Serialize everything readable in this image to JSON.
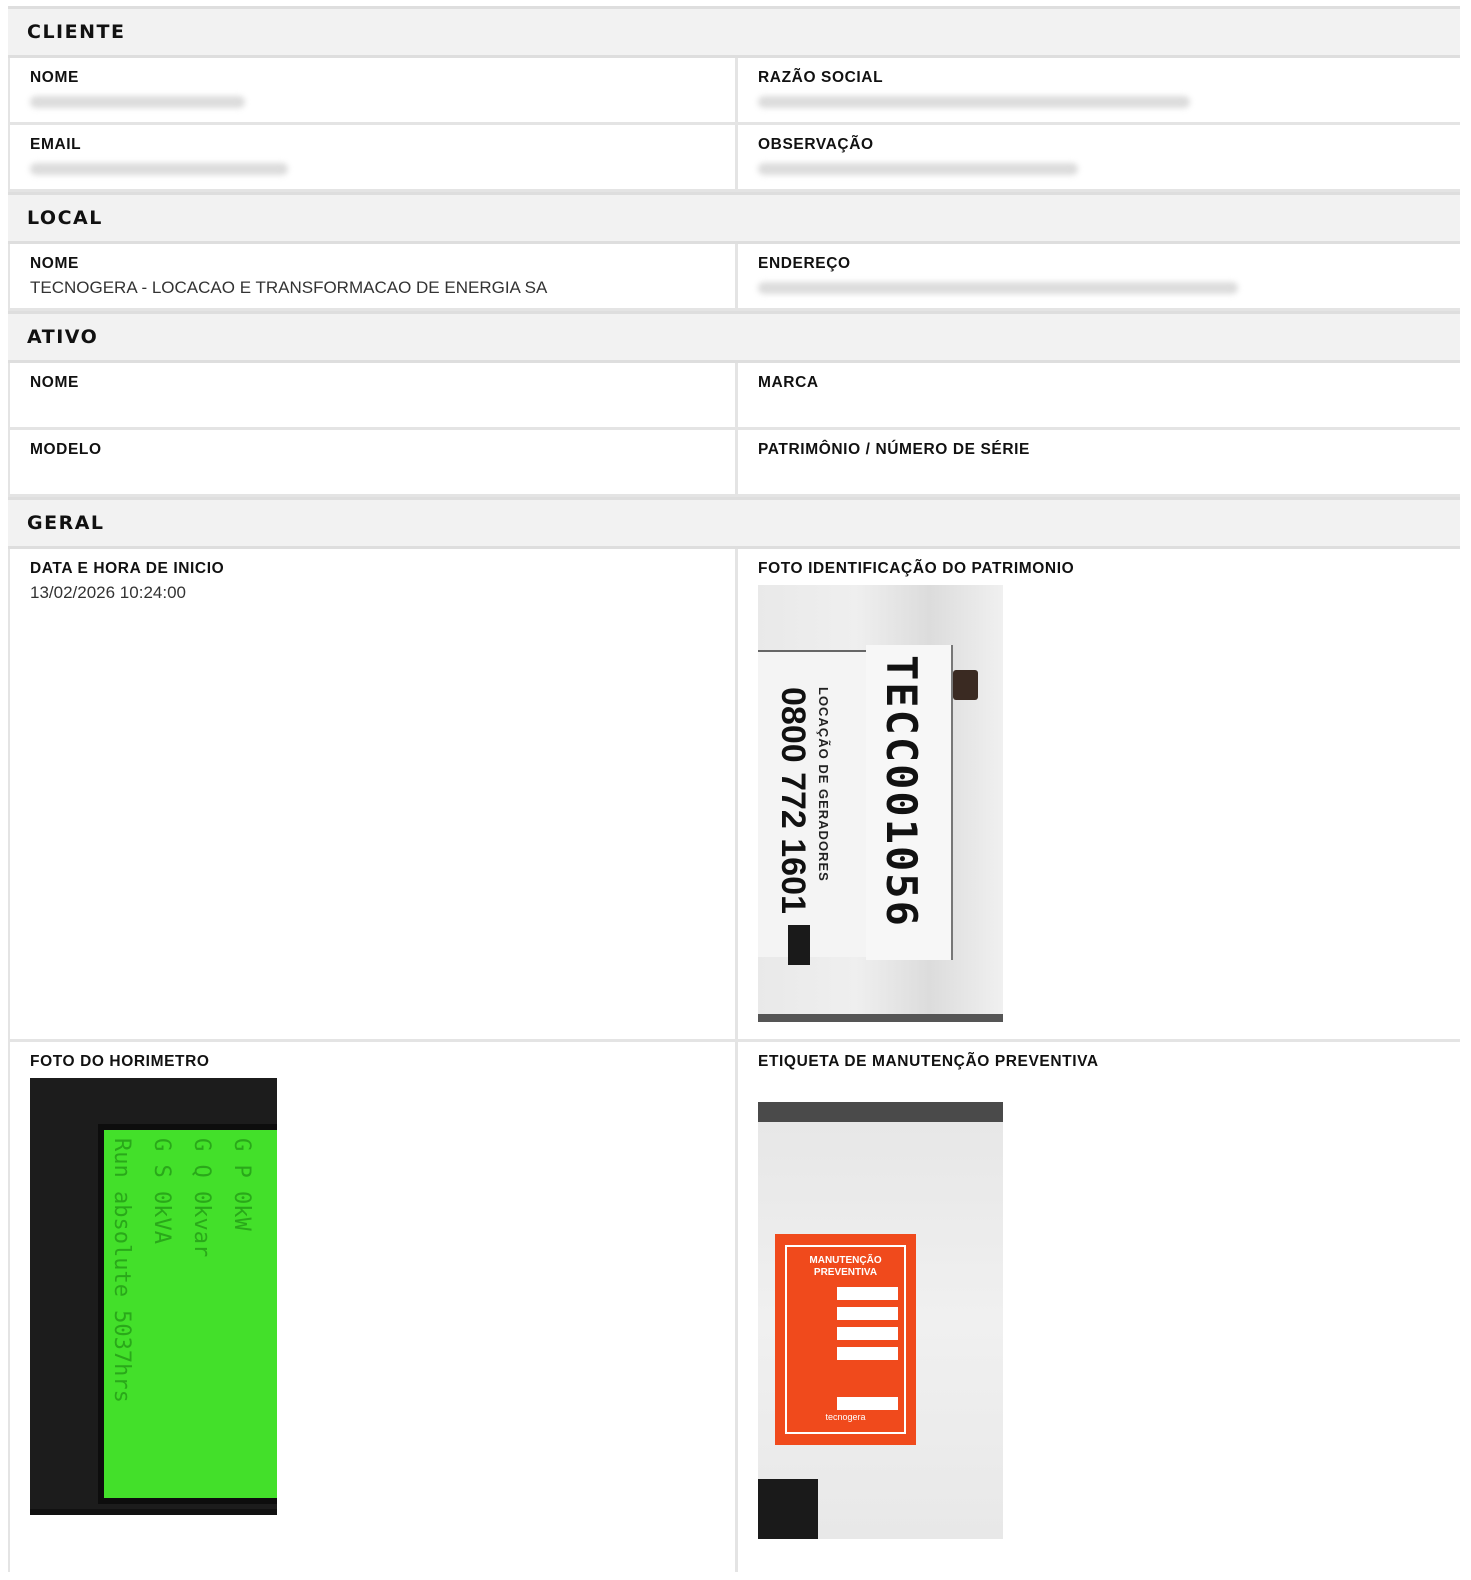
{
  "cliente": {
    "header": "CLIENTE",
    "nome_label": "NOME",
    "razao_label": "RAZÃO SOCIAL",
    "email_label": "EMAIL",
    "observacao_label": "OBSERVAÇÃO"
  },
  "local": {
    "header": "LOCAL",
    "nome_label": "NOME",
    "nome_value": "TECNOGERA - LOCACAO E TRANSFORMACAO DE ENERGIA SA",
    "endereco_label": "ENDEREÇO"
  },
  "ativo": {
    "header": "ATIVO",
    "nome_label": "NOME",
    "marca_label": "MARCA",
    "modelo_label": "MODELO",
    "patrimonio_label": "PATRIMÔNIO / NÚMERO DE SÉRIE"
  },
  "geral": {
    "header": "GERAL",
    "data_inicio_label": "DATA E HORA DE INICIO",
    "data_inicio_value": "13/02/2026 10:24:00",
    "foto_patrimonio_label": "FOTO IDENTIFICAÇÃO DO PATRIMONIO",
    "foto_horimetro_label": "FOTO DO HORIMETRO",
    "etiqueta_label": "ETIQUETA DE MANUTENÇÃO PREVENTIVA"
  },
  "photo_patrimonio": {
    "code": "TECC001056",
    "phone": "0800 772 1601",
    "tagline": "LOCAÇÃO DE GERADORES"
  },
  "photo_horimetro": {
    "col1": "Run absolute   5037hrs",
    "col2": "G S   0kVA",
    "col3": "G Q   0kvar",
    "col4": "G P   0kW"
  },
  "photo_etiqueta": {
    "title": "MANUTENÇÃO PREVENTIVA",
    "brand": "tecnogera"
  },
  "colors": {
    "sticker": "#f04a1c",
    "screen": "#43e02a"
  }
}
